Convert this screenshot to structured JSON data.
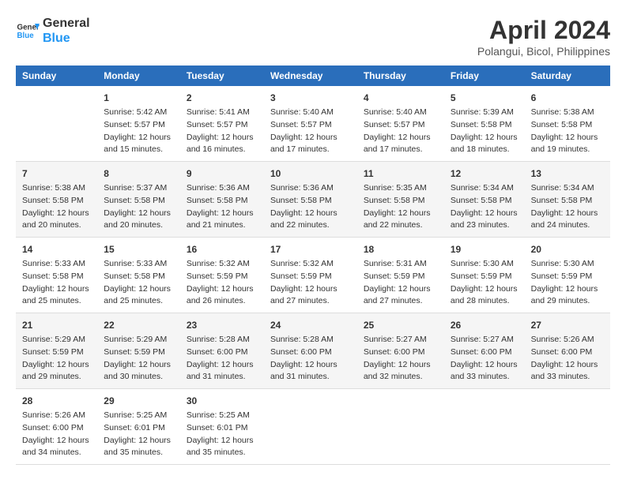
{
  "logo": {
    "line1": "General",
    "line2": "Blue"
  },
  "title": "April 2024",
  "subtitle": "Polangui, Bicol, Philippines",
  "columns": [
    "Sunday",
    "Monday",
    "Tuesday",
    "Wednesday",
    "Thursday",
    "Friday",
    "Saturday"
  ],
  "weeks": [
    [
      {
        "day": "",
        "sunrise": "",
        "sunset": "",
        "daylight": ""
      },
      {
        "day": "1",
        "sunrise": "Sunrise: 5:42 AM",
        "sunset": "Sunset: 5:57 PM",
        "daylight": "Daylight: 12 hours and 15 minutes."
      },
      {
        "day": "2",
        "sunrise": "Sunrise: 5:41 AM",
        "sunset": "Sunset: 5:57 PM",
        "daylight": "Daylight: 12 hours and 16 minutes."
      },
      {
        "day": "3",
        "sunrise": "Sunrise: 5:40 AM",
        "sunset": "Sunset: 5:57 PM",
        "daylight": "Daylight: 12 hours and 17 minutes."
      },
      {
        "day": "4",
        "sunrise": "Sunrise: 5:40 AM",
        "sunset": "Sunset: 5:57 PM",
        "daylight": "Daylight: 12 hours and 17 minutes."
      },
      {
        "day": "5",
        "sunrise": "Sunrise: 5:39 AM",
        "sunset": "Sunset: 5:58 PM",
        "daylight": "Daylight: 12 hours and 18 minutes."
      },
      {
        "day": "6",
        "sunrise": "Sunrise: 5:38 AM",
        "sunset": "Sunset: 5:58 PM",
        "daylight": "Daylight: 12 hours and 19 minutes."
      }
    ],
    [
      {
        "day": "7",
        "sunrise": "Sunrise: 5:38 AM",
        "sunset": "Sunset: 5:58 PM",
        "daylight": "Daylight: 12 hours and 20 minutes."
      },
      {
        "day": "8",
        "sunrise": "Sunrise: 5:37 AM",
        "sunset": "Sunset: 5:58 PM",
        "daylight": "Daylight: 12 hours and 20 minutes."
      },
      {
        "day": "9",
        "sunrise": "Sunrise: 5:36 AM",
        "sunset": "Sunset: 5:58 PM",
        "daylight": "Daylight: 12 hours and 21 minutes."
      },
      {
        "day": "10",
        "sunrise": "Sunrise: 5:36 AM",
        "sunset": "Sunset: 5:58 PM",
        "daylight": "Daylight: 12 hours and 22 minutes."
      },
      {
        "day": "11",
        "sunrise": "Sunrise: 5:35 AM",
        "sunset": "Sunset: 5:58 PM",
        "daylight": "Daylight: 12 hours and 22 minutes."
      },
      {
        "day": "12",
        "sunrise": "Sunrise: 5:34 AM",
        "sunset": "Sunset: 5:58 PM",
        "daylight": "Daylight: 12 hours and 23 minutes."
      },
      {
        "day": "13",
        "sunrise": "Sunrise: 5:34 AM",
        "sunset": "Sunset: 5:58 PM",
        "daylight": "Daylight: 12 hours and 24 minutes."
      }
    ],
    [
      {
        "day": "14",
        "sunrise": "Sunrise: 5:33 AM",
        "sunset": "Sunset: 5:58 PM",
        "daylight": "Daylight: 12 hours and 25 minutes."
      },
      {
        "day": "15",
        "sunrise": "Sunrise: 5:33 AM",
        "sunset": "Sunset: 5:58 PM",
        "daylight": "Daylight: 12 hours and 25 minutes."
      },
      {
        "day": "16",
        "sunrise": "Sunrise: 5:32 AM",
        "sunset": "Sunset: 5:59 PM",
        "daylight": "Daylight: 12 hours and 26 minutes."
      },
      {
        "day": "17",
        "sunrise": "Sunrise: 5:32 AM",
        "sunset": "Sunset: 5:59 PM",
        "daylight": "Daylight: 12 hours and 27 minutes."
      },
      {
        "day": "18",
        "sunrise": "Sunrise: 5:31 AM",
        "sunset": "Sunset: 5:59 PM",
        "daylight": "Daylight: 12 hours and 27 minutes."
      },
      {
        "day": "19",
        "sunrise": "Sunrise: 5:30 AM",
        "sunset": "Sunset: 5:59 PM",
        "daylight": "Daylight: 12 hours and 28 minutes."
      },
      {
        "day": "20",
        "sunrise": "Sunrise: 5:30 AM",
        "sunset": "Sunset: 5:59 PM",
        "daylight": "Daylight: 12 hours and 29 minutes."
      }
    ],
    [
      {
        "day": "21",
        "sunrise": "Sunrise: 5:29 AM",
        "sunset": "Sunset: 5:59 PM",
        "daylight": "Daylight: 12 hours and 29 minutes."
      },
      {
        "day": "22",
        "sunrise": "Sunrise: 5:29 AM",
        "sunset": "Sunset: 5:59 PM",
        "daylight": "Daylight: 12 hours and 30 minutes."
      },
      {
        "day": "23",
        "sunrise": "Sunrise: 5:28 AM",
        "sunset": "Sunset: 6:00 PM",
        "daylight": "Daylight: 12 hours and 31 minutes."
      },
      {
        "day": "24",
        "sunrise": "Sunrise: 5:28 AM",
        "sunset": "Sunset: 6:00 PM",
        "daylight": "Daylight: 12 hours and 31 minutes."
      },
      {
        "day": "25",
        "sunrise": "Sunrise: 5:27 AM",
        "sunset": "Sunset: 6:00 PM",
        "daylight": "Daylight: 12 hours and 32 minutes."
      },
      {
        "day": "26",
        "sunrise": "Sunrise: 5:27 AM",
        "sunset": "Sunset: 6:00 PM",
        "daylight": "Daylight: 12 hours and 33 minutes."
      },
      {
        "day": "27",
        "sunrise": "Sunrise: 5:26 AM",
        "sunset": "Sunset: 6:00 PM",
        "daylight": "Daylight: 12 hours and 33 minutes."
      }
    ],
    [
      {
        "day": "28",
        "sunrise": "Sunrise: 5:26 AM",
        "sunset": "Sunset: 6:00 PM",
        "daylight": "Daylight: 12 hours and 34 minutes."
      },
      {
        "day": "29",
        "sunrise": "Sunrise: 5:25 AM",
        "sunset": "Sunset: 6:01 PM",
        "daylight": "Daylight: 12 hours and 35 minutes."
      },
      {
        "day": "30",
        "sunrise": "Sunrise: 5:25 AM",
        "sunset": "Sunset: 6:01 PM",
        "daylight": "Daylight: 12 hours and 35 minutes."
      },
      {
        "day": "",
        "sunrise": "",
        "sunset": "",
        "daylight": ""
      },
      {
        "day": "",
        "sunrise": "",
        "sunset": "",
        "daylight": ""
      },
      {
        "day": "",
        "sunrise": "",
        "sunset": "",
        "daylight": ""
      },
      {
        "day": "",
        "sunrise": "",
        "sunset": "",
        "daylight": ""
      }
    ]
  ]
}
